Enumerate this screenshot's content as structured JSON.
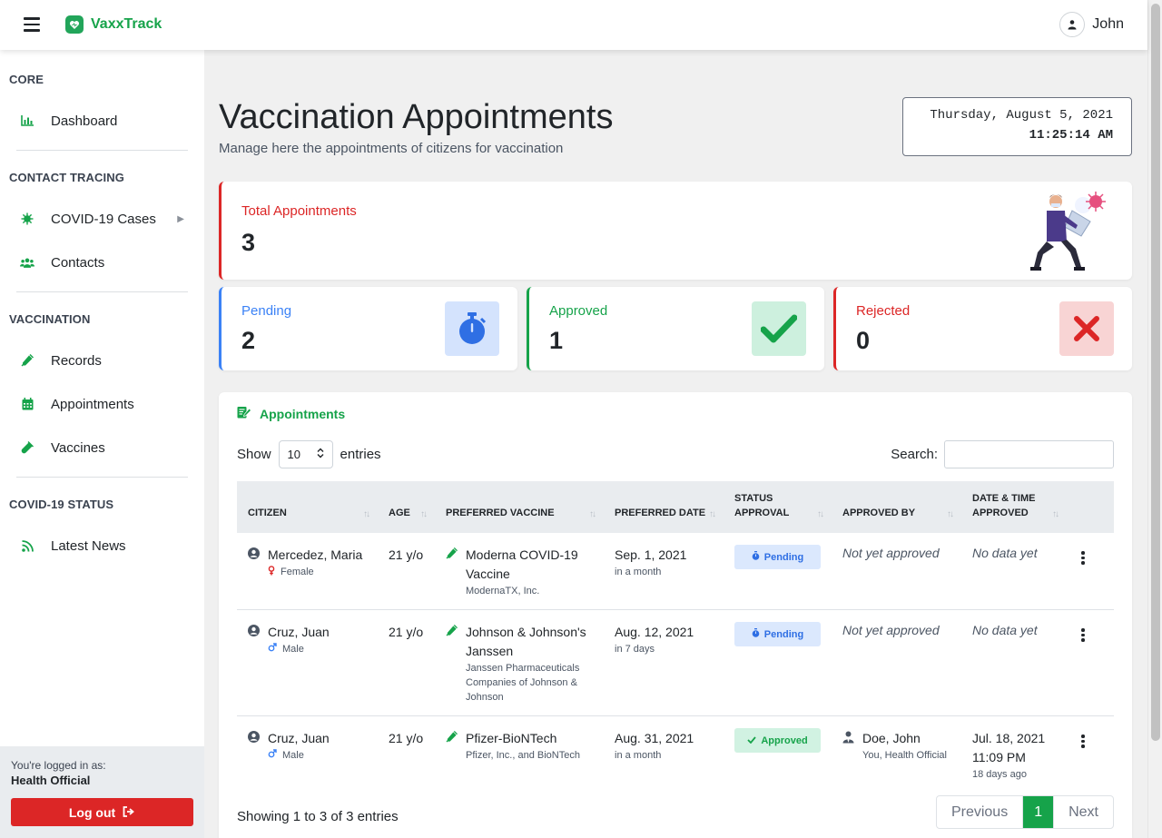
{
  "brand": {
    "name": "VaxxTrack"
  },
  "user": {
    "name": "John"
  },
  "sidebar": {
    "sections": [
      {
        "heading": "CORE"
      },
      {
        "heading": "CONTACT TRACING"
      },
      {
        "heading": "VACCINATION"
      },
      {
        "heading": "COVID-19 STATUS"
      }
    ],
    "items": [
      {
        "label": "Dashboard",
        "icon": "bar-chart-icon"
      },
      {
        "label": "COVID-19 Cases",
        "icon": "virus-icon"
      },
      {
        "label": "Contacts",
        "icon": "users-icon"
      },
      {
        "label": "Records",
        "icon": "syringe-icon"
      },
      {
        "label": "Appointments",
        "icon": "calendar-icon"
      },
      {
        "label": "Vaccines",
        "icon": "vial-icon"
      },
      {
        "label": "Latest News",
        "icon": "rss-icon"
      }
    ],
    "footer": {
      "logged_as": "You're logged in as:",
      "role": "Health Official",
      "logout": "Log out"
    }
  },
  "page": {
    "title": "Vaccination Appointments",
    "subtitle": "Manage here the appointments of citizens for vaccination"
  },
  "clock": {
    "date": "Thursday, August 5, 2021",
    "time": "11:25:14 AM"
  },
  "stats": {
    "total": {
      "label": "Total Appointments",
      "value": "3"
    },
    "pending": {
      "label": "Pending",
      "value": "2"
    },
    "approved": {
      "label": "Approved",
      "value": "1"
    },
    "rejected": {
      "label": "Rejected",
      "value": "0"
    }
  },
  "colors": {
    "green": "#16a34a",
    "red": "#dc2626",
    "blue": "#3b82f6"
  },
  "appointments": {
    "title": "Appointments",
    "show": "Show",
    "entries_value": "10",
    "entries": "entries",
    "search": "Search:",
    "headers": {
      "citizen": "CITIZEN",
      "age": "AGE",
      "vaccine": "PREFERRED VACCINE",
      "date": "PREFERRED DATE",
      "status_1": "STATUS",
      "status_2": "APPROVAL",
      "approved_by": "APPROVED BY",
      "dt_1": "DATE & TIME",
      "dt_2": "APPROVED"
    },
    "rows": [
      {
        "name": "Mercedez, Maria",
        "gender": "Female",
        "age": "21 y/o",
        "vaccine_1": "Moderna COVID-19",
        "vaccine_2": "Vaccine",
        "maker_1": "ModernaTX, Inc.",
        "maker_2": "",
        "maker_3": "",
        "date": "Sep. 1, 2021",
        "date_rel": "in a month",
        "status": "Pending",
        "approved_by": "Not yet approved",
        "approved_by_sub": "",
        "dt": "No data yet",
        "dt_2": "",
        "dt_rel": ""
      },
      {
        "name": "Cruz, Juan",
        "gender": "Male",
        "age": "21 y/o",
        "vaccine_1": "Johnson & Johnson's",
        "vaccine_2": "Janssen",
        "maker_1": "Janssen Pharmaceuticals",
        "maker_2": "Companies of Johnson &",
        "maker_3": "Johnson",
        "date": "Aug. 12, 2021",
        "date_rel": "in 7 days",
        "status": "Pending",
        "approved_by": "Not yet approved",
        "approved_by_sub": "",
        "dt": "No data yet",
        "dt_2": "",
        "dt_rel": ""
      },
      {
        "name": "Cruz, Juan",
        "gender": "Male",
        "age": "21 y/o",
        "vaccine_1": "Pfizer-BioNTech",
        "vaccine_2": "",
        "maker_1": "Pfizer, Inc., and BioNTech",
        "maker_2": "",
        "maker_3": "",
        "date": "Aug. 31, 2021",
        "date_rel": "in a month",
        "status": "Approved",
        "approved_by": "Doe, John",
        "approved_by_sub": "You, Health Official",
        "dt": "Jul. 18, 2021",
        "dt_2": "11:09 PM",
        "dt_rel": "18 days ago"
      }
    ],
    "showing": "Showing 1 to 3 of 3 entries",
    "pager": {
      "prev": "Previous",
      "page": "1",
      "next": "Next"
    }
  }
}
